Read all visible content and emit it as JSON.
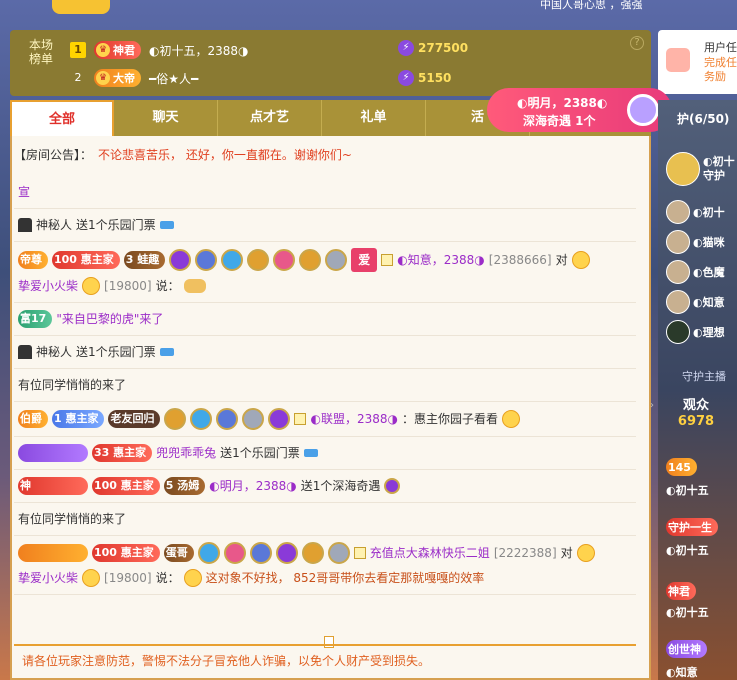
{
  "rank": {
    "title": "本场榜单",
    "rows": [
      {
        "num": "1",
        "badge": "神君",
        "name": "◐初十五，2388◑",
        "score": "277500"
      },
      {
        "num": "2",
        "badge": "大帝",
        "name": "━俗★人━",
        "score": "5150"
      }
    ],
    "help": "?"
  },
  "side_card": {
    "title": "用户任",
    "sub": "完成任务励"
  },
  "tabs": [
    "全部",
    "聊天",
    "点才艺",
    "礼单",
    "活"
  ],
  "announcement": {
    "label": "【房间公告】：",
    "text": "不论悲喜苦乐， 还好，你一直都在。谢谢你们~"
  },
  "messages": [
    {
      "type": "partial",
      "text": "宣"
    },
    {
      "type": "gift",
      "user": "神秘人",
      "text": "送1个乐园门票"
    },
    {
      "type": "chat",
      "badges": [
        "帝尊",
        "100 惠主家",
        "3 蛙趣"
      ],
      "love": "爱",
      "name": "◐知意，2388◑",
      "id": "[2388666]",
      "to": "对",
      "target": "挚爱小火柴",
      "target_id": "[19800]",
      "verb": "说："
    },
    {
      "type": "enter",
      "badge": "富17",
      "text": "\"来自巴黎的虎\"来了"
    },
    {
      "type": "gift",
      "user": "神秘人",
      "text": "送1个乐园门票"
    },
    {
      "type": "system",
      "text": "有位同学悄悄的来了"
    },
    {
      "type": "chat2",
      "badges": [
        "伯爵",
        "1 惠主家",
        "老友回归"
      ],
      "name": "◐联盟，2388◑",
      "text": "：惠主你园子看看"
    },
    {
      "type": "gift2",
      "badges": [
        "",
        "33 惠主家"
      ],
      "name": "兜兜乖乖兔",
      "text": "送1个乐园门票"
    },
    {
      "type": "gift3",
      "badges": [
        "神",
        "100 惠主家",
        "5 汤姆"
      ],
      "name": "◐明月，2388◑",
      "text": "送1个深海奇遇"
    },
    {
      "type": "system",
      "text": "有位同学悄悄的来了"
    },
    {
      "type": "chat3",
      "badges": [
        "",
        "100 惠主家",
        "蛋哥"
      ],
      "name": "充值点大森林快乐二姐",
      "id": "[2222388]",
      "to": "对",
      "target": "挚爱小火柴",
      "target_id": "[19800]",
      "verb": "说：",
      "text": "这对象不好找， 852哥哥带你去看定那就嘎嘎的效率"
    }
  ],
  "notice": "请各位玩家注意防范，警惕不法分子冒充他人诈骗，以免个人财产受到损失。",
  "popup": {
    "line1": "◐明月，2388◐",
    "line2": "深海奇遇 1个"
  },
  "guard": {
    "header": "护(6/50)",
    "items": [
      {
        "name": "◐初十",
        "sub": "守护"
      },
      {
        "name": "◐初十"
      },
      {
        "name": "◐猫咪"
      },
      {
        "name": "◐色魔"
      },
      {
        "name": "◐知意"
      },
      {
        "name": "◐理想"
      }
    ],
    "link": "守护主播"
  },
  "viewers": {
    "label": "观众",
    "count": "6978"
  },
  "right_list": [
    "145",
    "◐初十五",
    "守护一生",
    "◐初十五",
    "神君",
    "◐初十五",
    "创世神",
    "◐知意"
  ],
  "top_text": "中国人哥心思 ，强强"
}
